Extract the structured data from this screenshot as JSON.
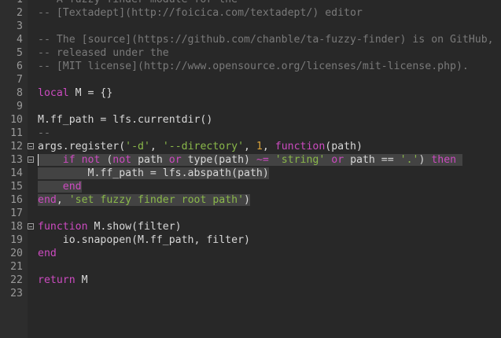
{
  "editor": {
    "lines": [
      {
        "n": "1",
        "tokens": [
          {
            "c": "comment",
            "t": "-- A fuzzy finder module for the"
          }
        ]
      },
      {
        "n": "2",
        "tokens": [
          {
            "c": "comment",
            "t": "-- [Textadept](http://foicica.com/textadept/) editor"
          }
        ]
      },
      {
        "n": "3",
        "tokens": []
      },
      {
        "n": "4",
        "tokens": [
          {
            "c": "comment",
            "t": "-- The [source](https://github.com/chanble/ta-fuzzy-finder) is on GitHub,"
          }
        ]
      },
      {
        "n": "5",
        "tokens": [
          {
            "c": "comment",
            "t": "-- released under the"
          }
        ]
      },
      {
        "n": "6",
        "tokens": [
          {
            "c": "comment",
            "t": "-- [MIT license](http://www.opensource.org/licenses/mit-license.php)."
          }
        ]
      },
      {
        "n": "7",
        "tokens": []
      },
      {
        "n": "8",
        "tokens": [
          {
            "c": "kw",
            "t": "local"
          },
          {
            "c": "plain",
            "t": " M = {}"
          }
        ]
      },
      {
        "n": "9",
        "tokens": []
      },
      {
        "n": "10",
        "tokens": [
          {
            "c": "plain",
            "t": "M.ff_path = lfs.currentdir()"
          }
        ]
      },
      {
        "n": "11",
        "tokens": [
          {
            "c": "comment",
            "t": "--"
          }
        ]
      },
      {
        "n": "12",
        "fold": true,
        "tokens": [
          {
            "c": "plain",
            "t": "args.register("
          },
          {
            "c": "str",
            "t": "'-d'"
          },
          {
            "c": "plain",
            "t": ", "
          },
          {
            "c": "str",
            "t": "'--directory'"
          },
          {
            "c": "plain",
            "t": ", "
          },
          {
            "c": "num",
            "t": "1"
          },
          {
            "c": "plain",
            "t": ", "
          },
          {
            "c": "kw",
            "t": "function"
          },
          {
            "c": "plain",
            "t": "(path)"
          }
        ]
      },
      {
        "n": "13",
        "fold": true,
        "caret": true,
        "sel": true,
        "tokens": [
          {
            "c": "plain",
            "t": "    "
          },
          {
            "c": "kw",
            "t": "if not"
          },
          {
            "c": "plain",
            "t": " ("
          },
          {
            "c": "kw",
            "t": "not"
          },
          {
            "c": "plain",
            "t": " path "
          },
          {
            "c": "kw",
            "t": "or"
          },
          {
            "c": "plain",
            "t": " type(path) "
          },
          {
            "c": "kw",
            "t": "~="
          },
          {
            "c": "plain",
            "t": " "
          },
          {
            "c": "str",
            "t": "'string'"
          },
          {
            "c": "plain",
            "t": " "
          },
          {
            "c": "kw",
            "t": "or"
          },
          {
            "c": "plain",
            "t": " path == "
          },
          {
            "c": "str",
            "t": "'.'"
          },
          {
            "c": "plain",
            "t": ") "
          },
          {
            "c": "kw",
            "t": "then"
          },
          {
            "c": "plain",
            "t": " "
          }
        ]
      },
      {
        "n": "14",
        "sel": true,
        "tokens": [
          {
            "c": "plain",
            "t": "        M.ff_path = lfs.abspath(path)"
          }
        ]
      },
      {
        "n": "15",
        "sel": true,
        "tokens": [
          {
            "c": "plain",
            "t": "    "
          },
          {
            "c": "kw",
            "t": "end"
          }
        ]
      },
      {
        "n": "16",
        "sel": true,
        "tokens": [
          {
            "c": "kw",
            "t": "end"
          },
          {
            "c": "plain",
            "t": ", "
          },
          {
            "c": "str",
            "t": "'set fuzzy finder root path'"
          },
          {
            "c": "plain",
            "t": ")"
          }
        ]
      },
      {
        "n": "17",
        "tokens": []
      },
      {
        "n": "18",
        "fold": true,
        "tokens": [
          {
            "c": "kw",
            "t": "function"
          },
          {
            "c": "plain",
            "t": " M.show(filter)"
          }
        ]
      },
      {
        "n": "19",
        "tokens": [
          {
            "c": "plain",
            "t": "    io.snapopen(M.ff_path, filter)"
          }
        ]
      },
      {
        "n": "20",
        "tokens": [
          {
            "c": "kw",
            "t": "end"
          }
        ]
      },
      {
        "n": "21",
        "tokens": []
      },
      {
        "n": "22",
        "tokens": [
          {
            "c": "kw",
            "t": "return"
          },
          {
            "c": "plain",
            "t": " M"
          }
        ]
      },
      {
        "n": "23",
        "tokens": []
      }
    ]
  },
  "colors": {
    "background": "#282828",
    "gutter": "#2d2d2d",
    "comment": "#7a7a7a",
    "keyword": "#cc4bc0",
    "string": "#8ab84a",
    "number": "#d8a23a",
    "selection": "#434343"
  }
}
